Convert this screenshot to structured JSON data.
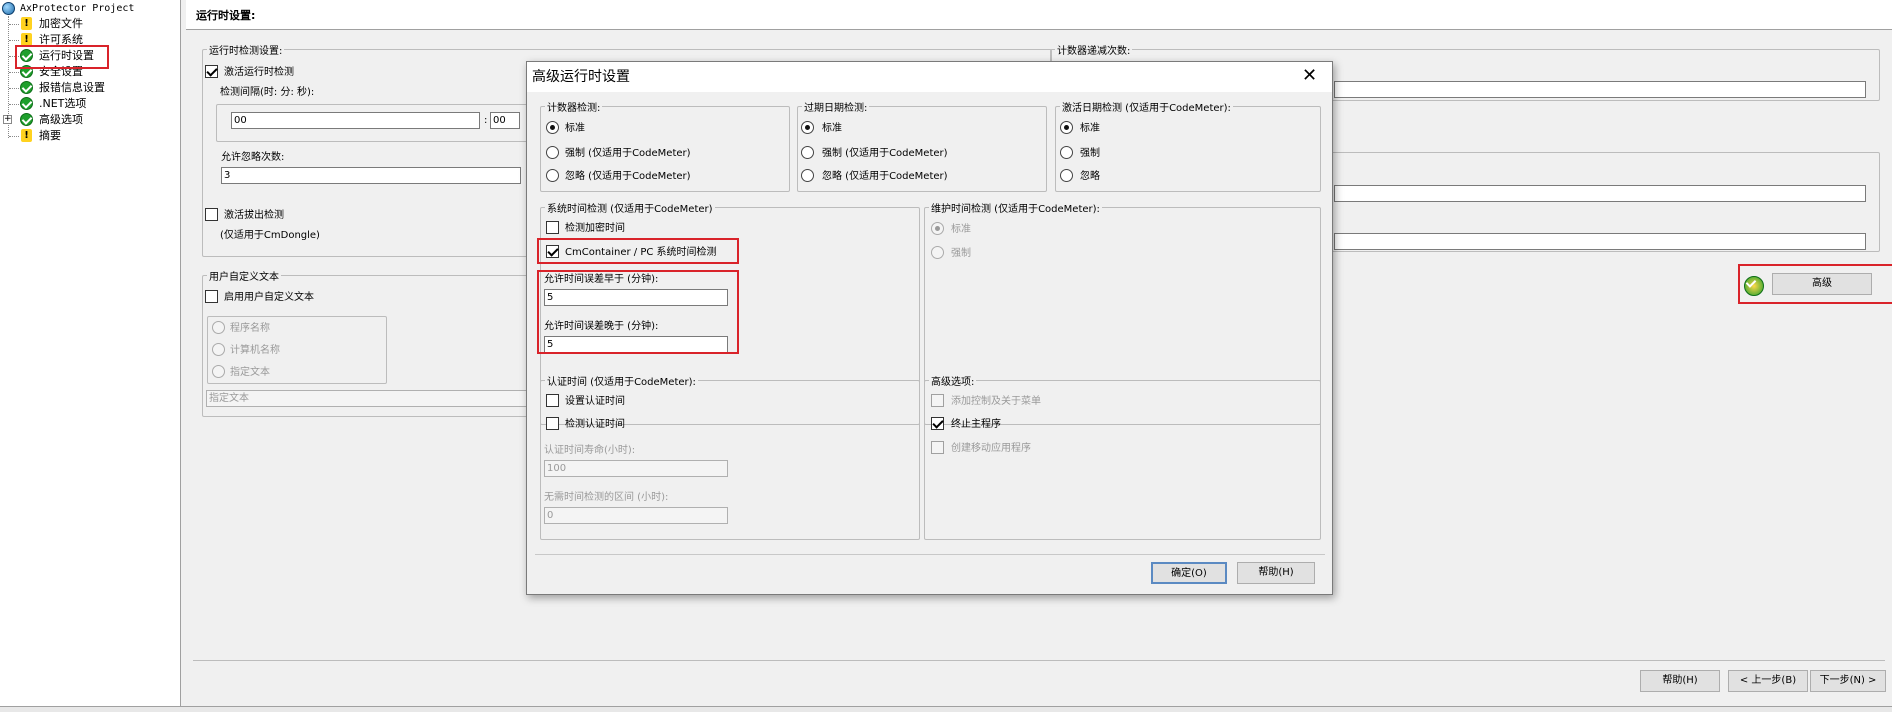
{
  "tree": {
    "root": "AxProtector Project",
    "items": [
      {
        "label": "加密文件",
        "icon": "warning-icon"
      },
      {
        "label": "许可系统",
        "icon": "warning-icon"
      },
      {
        "label": "运行时设置",
        "icon": "check-icon"
      },
      {
        "label": "安全设置",
        "icon": "check-icon"
      },
      {
        "label": "报错信息设置",
        "icon": "check-icon"
      },
      {
        "label": ".NET选项",
        "icon": "check-icon"
      },
      {
        "label": "高级选项",
        "icon": "check-icon"
      },
      {
        "label": "摘要",
        "icon": "warning-icon"
      }
    ]
  },
  "page": {
    "title": "运行时设置:",
    "runtime_check_group": "运行时检测设置:",
    "activate_runtime_check": "激活运行时检测",
    "interval_label": "检测间隔(时: 分: 秒):",
    "interval_hours": "00",
    "interval_sep": ":",
    "interval_minutes": "00",
    "ignore_count_label": "允许忽略次数:",
    "ignore_count_value": "3",
    "activate_unplug": "激活拔出检测",
    "unplug_note": "(仅适用于CmDongle)",
    "counter_group": "计数器递减次数:",
    "user_text_group": "用户自定义文本",
    "enable_user_text": "启用用户自定义文本",
    "radio_program_name": "程序名称",
    "radio_computer_name": "计算机名称",
    "radio_specified_text": "指定文本",
    "specified_text_placeholder": "指定文本",
    "advanced_button": "高级",
    "help_button": "帮助(H)",
    "prev_button": "< 上一步(B)",
    "next_button": "下一步(N) >"
  },
  "dialog": {
    "title": "高级运行时设置",
    "close": "✕",
    "counter_check": {
      "title": "计数器检测:",
      "options": [
        "标准",
        "强制 (仅适用于CodeMeter)",
        "忽略 (仅适用于CodeMeter)"
      ],
      "selected": 0
    },
    "expiry_check": {
      "title": "过期日期检测:",
      "options": [
        "标准",
        "强制 (仅适用于CodeMeter)",
        "忽略 (仅适用于CodeMeter)"
      ],
      "selected": 0
    },
    "activation_check": {
      "title": "激活日期检测 (仅适用于CodeMeter):",
      "options": [
        "标准",
        "强制",
        "忽略"
      ],
      "selected": 0
    },
    "system_time": {
      "title": "系统时间检测 (仅适用于CodeMeter)",
      "check_encrypt_time": "检测加密时间",
      "cmcontainer_check": "CmContainer / PC 系统时间检测",
      "early_label": "允许时间误差早于 (分钟):",
      "early_value": "5",
      "late_label": "允许时间误差晚于 (分钟):",
      "late_value": "5"
    },
    "maintenance": {
      "title": "维护时间检测 (仅适用于CodeMeter):",
      "options": [
        "标准",
        "强制"
      ]
    },
    "certified_time": {
      "title": "认证时间 (仅适用于CodeMeter):",
      "set_time": "设置认证时间",
      "check_time": "检测认证时间",
      "lifetime_label": "认证时间寿命(小时):",
      "lifetime_value": "100",
      "no_check_label": "无需时间检测的区间 (小时):",
      "no_check_value": "0"
    },
    "advanced_options": {
      "title": "高级选项:",
      "add_control": "添加控制及关于菜单",
      "terminate": "终止主程序",
      "mobile": "创建移动应用程序"
    },
    "ok_button": "确定(O)",
    "help_button": "帮助(H)"
  }
}
